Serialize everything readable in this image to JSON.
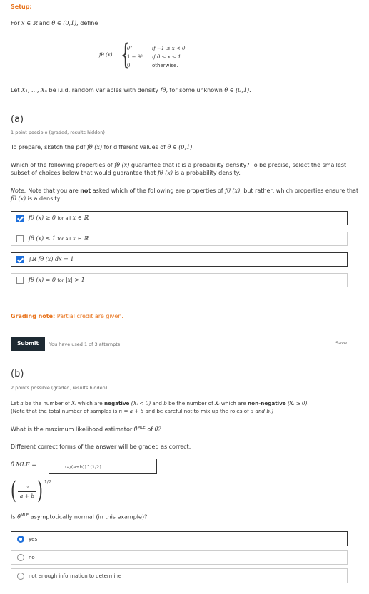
{
  "setup": {
    "heading": "Setup:",
    "intro_pre": "For",
    "intro_x": "x ∈ ℝ",
    "intro_and": "and",
    "intro_theta": "θ ∈ (0,1),",
    "intro_post": "define",
    "f_lhs": "fθ (x)",
    "cases": [
      {
        "value": "θ²",
        "condition": "if  −1 ≤ x < 0"
      },
      {
        "value": "1 − θ²",
        "condition": "if 0 ≤ x ≤ 1"
      },
      {
        "value": "0",
        "condition": "otherwise."
      }
    ],
    "iid_pre": "Let",
    "iid_vars": "X₁, …, Xₙ",
    "iid_mid": "be i.i.d. random variables with density",
    "iid_f": "fθ,",
    "iid_post": "for some unknown",
    "iid_theta": "θ ∈ (0,1)."
  },
  "part_a": {
    "label": "(a)",
    "points": "1 point possible (graded, results hidden)",
    "prompt_pre": "To prepare, sketch the pdf",
    "prompt_f": "fθ (x)",
    "prompt_post": "for different values of",
    "prompt_theta": "θ ∈ (0,1).",
    "question_1a": "Which of the following properties of",
    "question_1f": "fθ (x)",
    "question_1b": "guarantee that it is a probability density? To be precise, select the smallest",
    "question_2": "subset of choices below that would guarantee that",
    "question_2f": "fθ (x)",
    "question_2b": "is a probability density.",
    "note_label": "Note:",
    "note_1a": "Note that you are",
    "note_not": "not",
    "note_1b": "asked which of the following are properties of",
    "note_1f": "fθ (x),",
    "note_1c": "but rather, which properties ensure that",
    "note_2f": "fθ (x)",
    "note_2b": "is a density.",
    "choices": [
      {
        "math": "fθ (x) ≥ 0",
        "text": "for all",
        "math2": "x ∈ ℝ",
        "checked": true
      },
      {
        "math": "fθ (x) ≤ 1",
        "text": "for all",
        "math2": "x ∈ ℝ",
        "checked": false
      },
      {
        "math": "∫ℝ fθ (x) dx = 1",
        "text": "",
        "math2": "",
        "checked": true
      },
      {
        "math": "fθ (x) = 0",
        "text": "for",
        "math2": "|x| > 1",
        "checked": false
      }
    ],
    "grading_label": "Grading note:",
    "grading_text": "Partial credit are given.",
    "submit_label": "Submit",
    "attempts": "You have used 1 of 3 attempts",
    "save_label": "Save"
  },
  "part_b": {
    "label": "(b)",
    "points": "2 points possible (graded, results hidden)",
    "def_1a": "Let",
    "def_a": "a",
    "def_1b": "be the number of",
    "def_xi": "Xᵢ",
    "def_1c": "which are",
    "def_neg": "negative",
    "def_neg_cond": "(Xᵢ < 0)",
    "def_1d": "and",
    "def_b": "b",
    "def_1e": "be the number of",
    "def_xi2": "Xᵢ",
    "def_1f": "which are",
    "def_nonneg": "non-negative",
    "def_nonneg_cond": "(Xᵢ ≥ 0).",
    "def_2a": "(Note that the total number of samples is",
    "def_2m": "n = a + b",
    "def_2b": "and be careful not to mix up the roles of",
    "def_2c": "a and b.)",
    "mle_q_pre": "What is the maximum likelihood estimator",
    "mle_symbol": "θ̂",
    "mle_sup": "MLE",
    "mle_q_mid": "of",
    "mle_q_theta": "θ?",
    "forms_note": "Different correct forms of the answer will be graded as correct.",
    "input_label": "θ̂ MLE =",
    "input_value": "(a/(a+b))^(1/2)",
    "preview_num": "a",
    "preview_den": "a + b",
    "preview_exp": "1/2",
    "asym_pre": "Is",
    "asym_symbol": "θ̂",
    "asym_sup": "MLE",
    "asym_post": "asymptotically normal (in this example)?",
    "options": [
      {
        "label": "yes",
        "selected": true
      },
      {
        "label": "no",
        "selected": false
      },
      {
        "label": "not enough information to determine",
        "selected": false
      }
    ]
  }
}
